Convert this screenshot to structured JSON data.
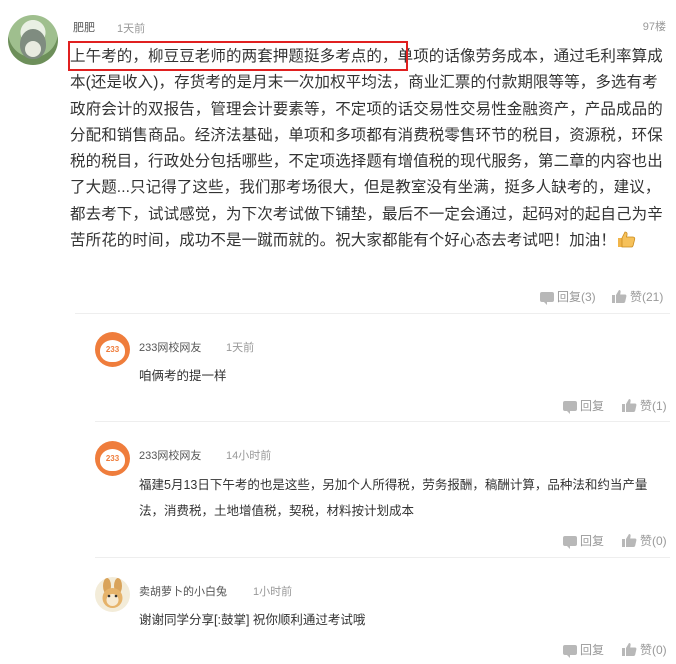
{
  "main_comment": {
    "username": "肥肥",
    "time": "1天前",
    "floor": "97楼",
    "text": "上午考的，柳豆豆老师的两套押题挺多考点的，单项的话像劳务成本，通过毛利率算成本(还是收入)，存货考的是月末一次加权平均法，商业汇票的付款期限等等，多选有考政府会计的双报告，管理会计要素等，不定项的话交易性交易性金融资产，产品成品的分配和销售商品。经济法基础，单项和多项都有消费税零售环节的税目，资源税，环保税的税目，行政处分包括哪些，不定项选择题有增值税的现代服务，第二章的内容也出了大题...只记得了这些，我们那考场很大，但是教室没有坐满，挺多人缺考的，建议，都去考下，试试感觉，为下次考试做下铺垫，最后不一定会通过，起码对的起自己为辛苦所花的时间，成功不是一蹴而就的。祝大家都能有个好心态去考试吧！加油！",
    "reply_label": "回复(3)",
    "like_label": "赞(21)",
    "thumb_icon": "thumbs-up-emoji"
  },
  "replies": [
    {
      "username": "233网校网友",
      "avatar_text": "233",
      "time": "1天前",
      "text": "咱俩考的提一样",
      "reply_label": "回复",
      "like_label": "赞(1)"
    },
    {
      "username": "233网校网友",
      "avatar_text": "233",
      "time": "14小时前",
      "text": "福建5月13日下午考的也是这些，另加个人所得税，劳务报酬，稿酬计算，品种法和约当产量法，消费税，土地增值税，契税，材料按计划成本",
      "reply_label": "回复",
      "like_label": "赞(0)"
    },
    {
      "username": "卖胡萝卜的小白兔",
      "time": "1小时前",
      "text": "谢谢同学分享[:鼓掌] 祝你顺利通过考试哦",
      "reply_label": "回复",
      "like_label": "赞(0)"
    }
  ],
  "colors": {
    "highlight_border": "#e02020",
    "avatar_233": "#ef7d3c",
    "meta_text": "#999999"
  }
}
